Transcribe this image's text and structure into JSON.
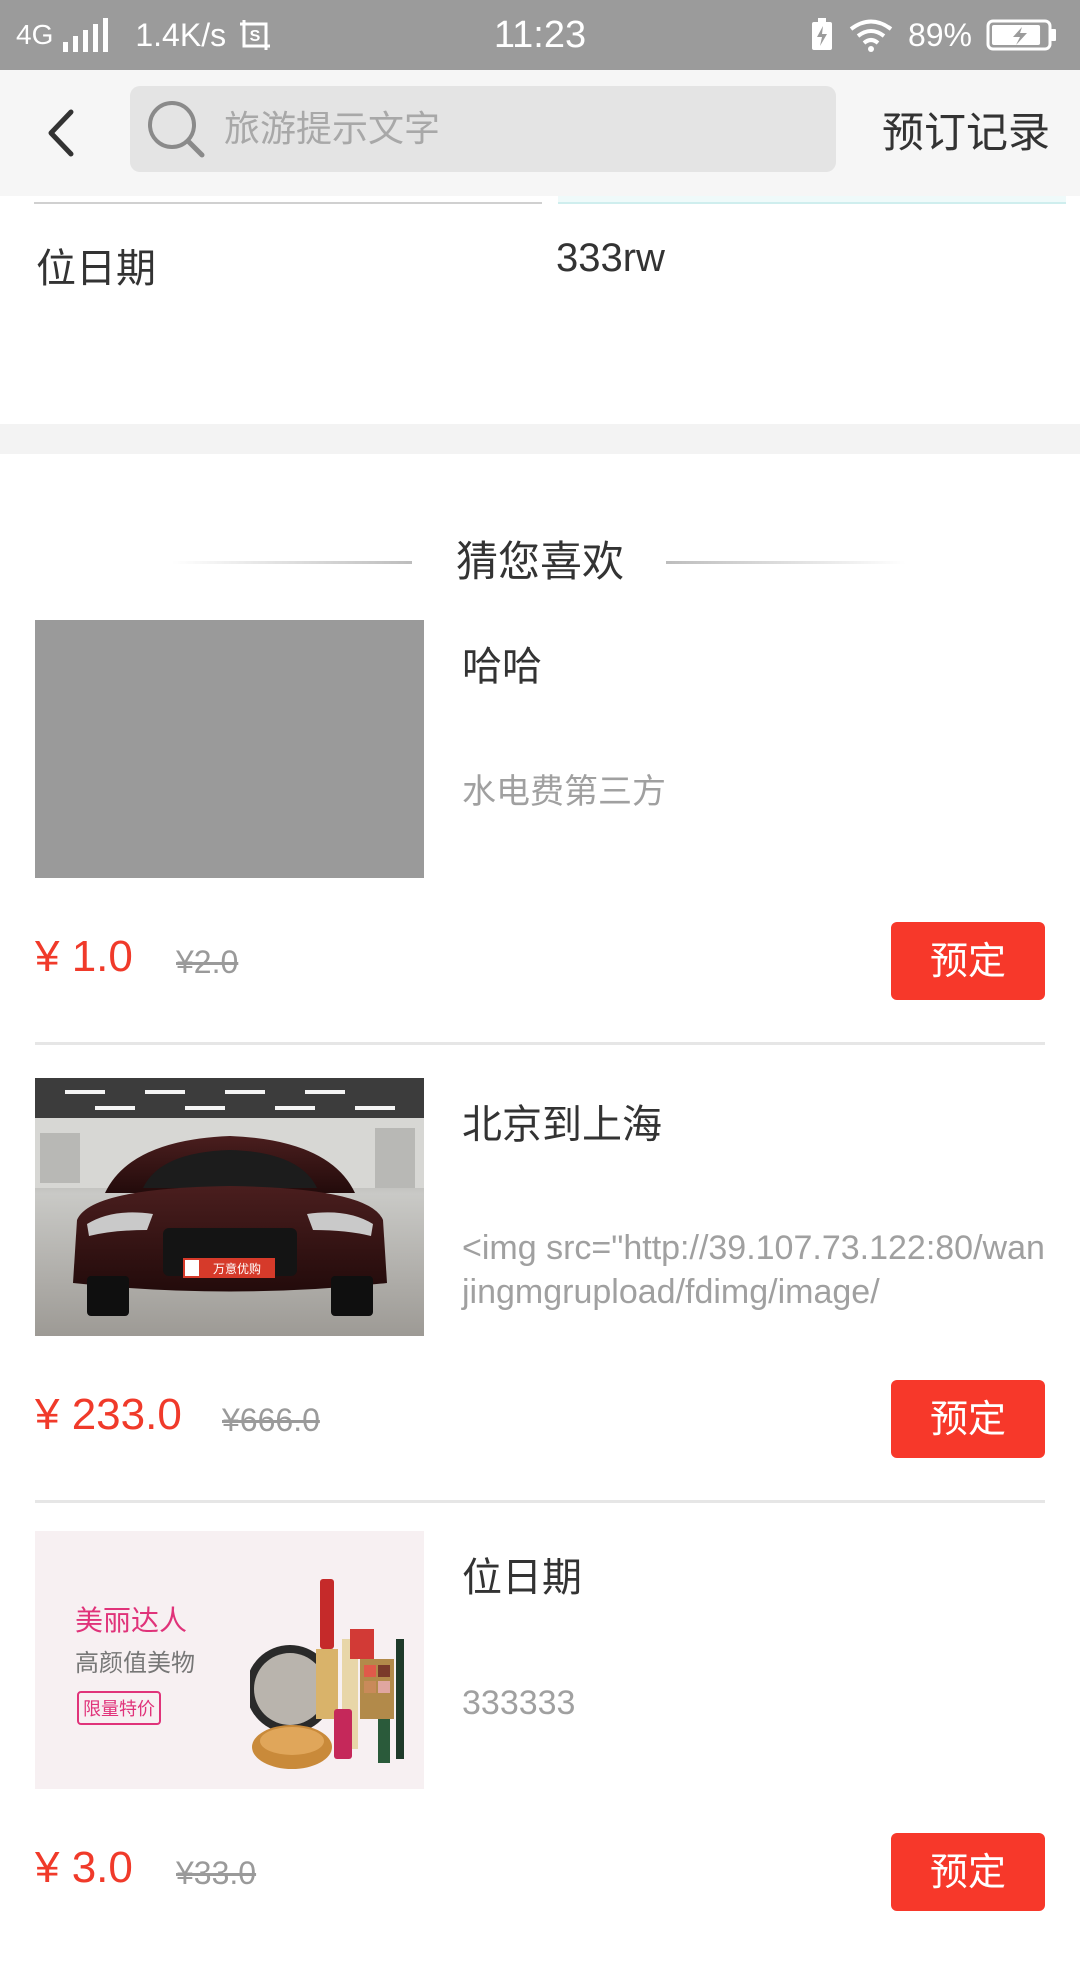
{
  "status_bar": {
    "network": "4G",
    "speed": "1.4K/s",
    "time": "11:23",
    "battery_percent": "89%",
    "signal_level": 1.0,
    "battery_level": 0.89
  },
  "header": {
    "back_icon": "chevron-left-icon",
    "search_icon": "search-icon",
    "search_placeholder": "旅游提示文字",
    "search_value": "",
    "record_label": "预订记录"
  },
  "top_info": {
    "name": "位日期",
    "value": "333rw"
  },
  "recommend": {
    "title": "猜您喜欢",
    "items": [
      {
        "title": "哈哈",
        "desc": "水电费第三方",
        "price": "¥ 1.0",
        "old_price": "¥2.0",
        "button": "预定",
        "image": "gray-placeholder-image"
      },
      {
        "title": "北京到上海",
        "desc": "<img src=\"http://39.107.73.122:80/wanjingmgrupload/fdimg/image/",
        "price": "¥ 233.0",
        "old_price": "¥666.0",
        "button": "预定",
        "image": "car-photo-image",
        "image_text": "万意优购"
      },
      {
        "title": "位日期",
        "desc": "333333",
        "price": "¥ 3.0",
        "old_price": "¥33.0",
        "button": "预定",
        "image": "cosmetics-promo-image",
        "image_text": [
          "美丽达人",
          "高颜值美物",
          "限量特价"
        ]
      }
    ]
  },
  "colors": {
    "status_bar": "#9b9b9b",
    "header_bg": "#f6f6f6",
    "price_red": "#f03a2a",
    "button_red": "#f7382a",
    "text_dark": "#333333",
    "text_muted": "#a0a0a0"
  }
}
